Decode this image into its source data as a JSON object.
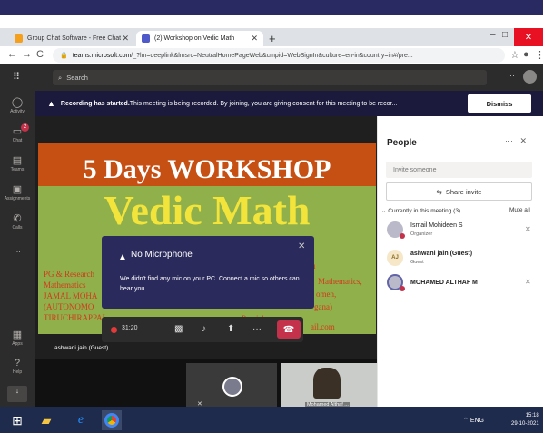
{
  "browser": {
    "tabs": [
      {
        "label": "Group Chat Software - Free Chat"
      },
      {
        "label": "(2) Workshop on Vedic Math"
      }
    ],
    "url_host": "teams.microsoft.com",
    "url_rest": "/_?lm=deeplink&lmsrc=NeutralHomePageWeb&cmpid=WebSignIn&culture=en-in&country=in#/pre..."
  },
  "teams": {
    "search_placeholder": "Search",
    "rail": [
      {
        "label": "Activity",
        "icon": "bell-icon"
      },
      {
        "label": "Chat",
        "icon": "chat-icon",
        "badge": "2"
      },
      {
        "label": "Teams",
        "icon": "teams-icon"
      },
      {
        "label": "Assignments",
        "icon": "assignments-icon"
      },
      {
        "label": "Calls",
        "icon": "phone-icon"
      },
      {
        "label": "...",
        "icon": "more-icon"
      },
      {
        "label": "Apps",
        "icon": "apps-icon"
      },
      {
        "label": "Help",
        "icon": "help-icon"
      }
    ]
  },
  "banner": {
    "bold": "Recording has started.",
    "text": " This meeting is being recorded. By joining, you are giving consent for this meeting to be recor...",
    "dismiss": "Dismiss"
  },
  "slide": {
    "title": "5 Days WORKSHOP",
    "big": "Vedic Math",
    "left_lines": [
      "PG & Research",
      "Mathematics",
      "JAMAL MOHA",
      "(AUTONOMO",
      "TIRUCHIRAPPAL"
    ],
    "right_lines": [
      "n",
      "Mathematics,",
      "omen,",
      "gana)",
      "Paraiah",
      "ail.com"
    ]
  },
  "popup": {
    "title": "No Microphone",
    "message": "We didn't find any mic on your PC. Connect a mic so others can hear you."
  },
  "call": {
    "timer": "31:20",
    "presenter_name": "ashwani jain (Guest)",
    "tile_name": "Mohamed Althaf ..."
  },
  "people": {
    "title": "People",
    "invite_placeholder": "Invite someone",
    "share_invite": "Share invite",
    "section": "Currently in this meeting (3)",
    "mute_all": "Mute all",
    "participants": [
      {
        "name": "Ismail Mohideen S",
        "role": "Organizer",
        "initials": ""
      },
      {
        "name": "ashwani jain (Guest)",
        "role": "Guest",
        "initials": "AJ"
      },
      {
        "name": "MOHAMED ALTHAF M",
        "role": "",
        "initials": ""
      }
    ]
  },
  "taskbar": {
    "time": "15:18",
    "date": "29-10-2021",
    "lang": "ENG"
  }
}
